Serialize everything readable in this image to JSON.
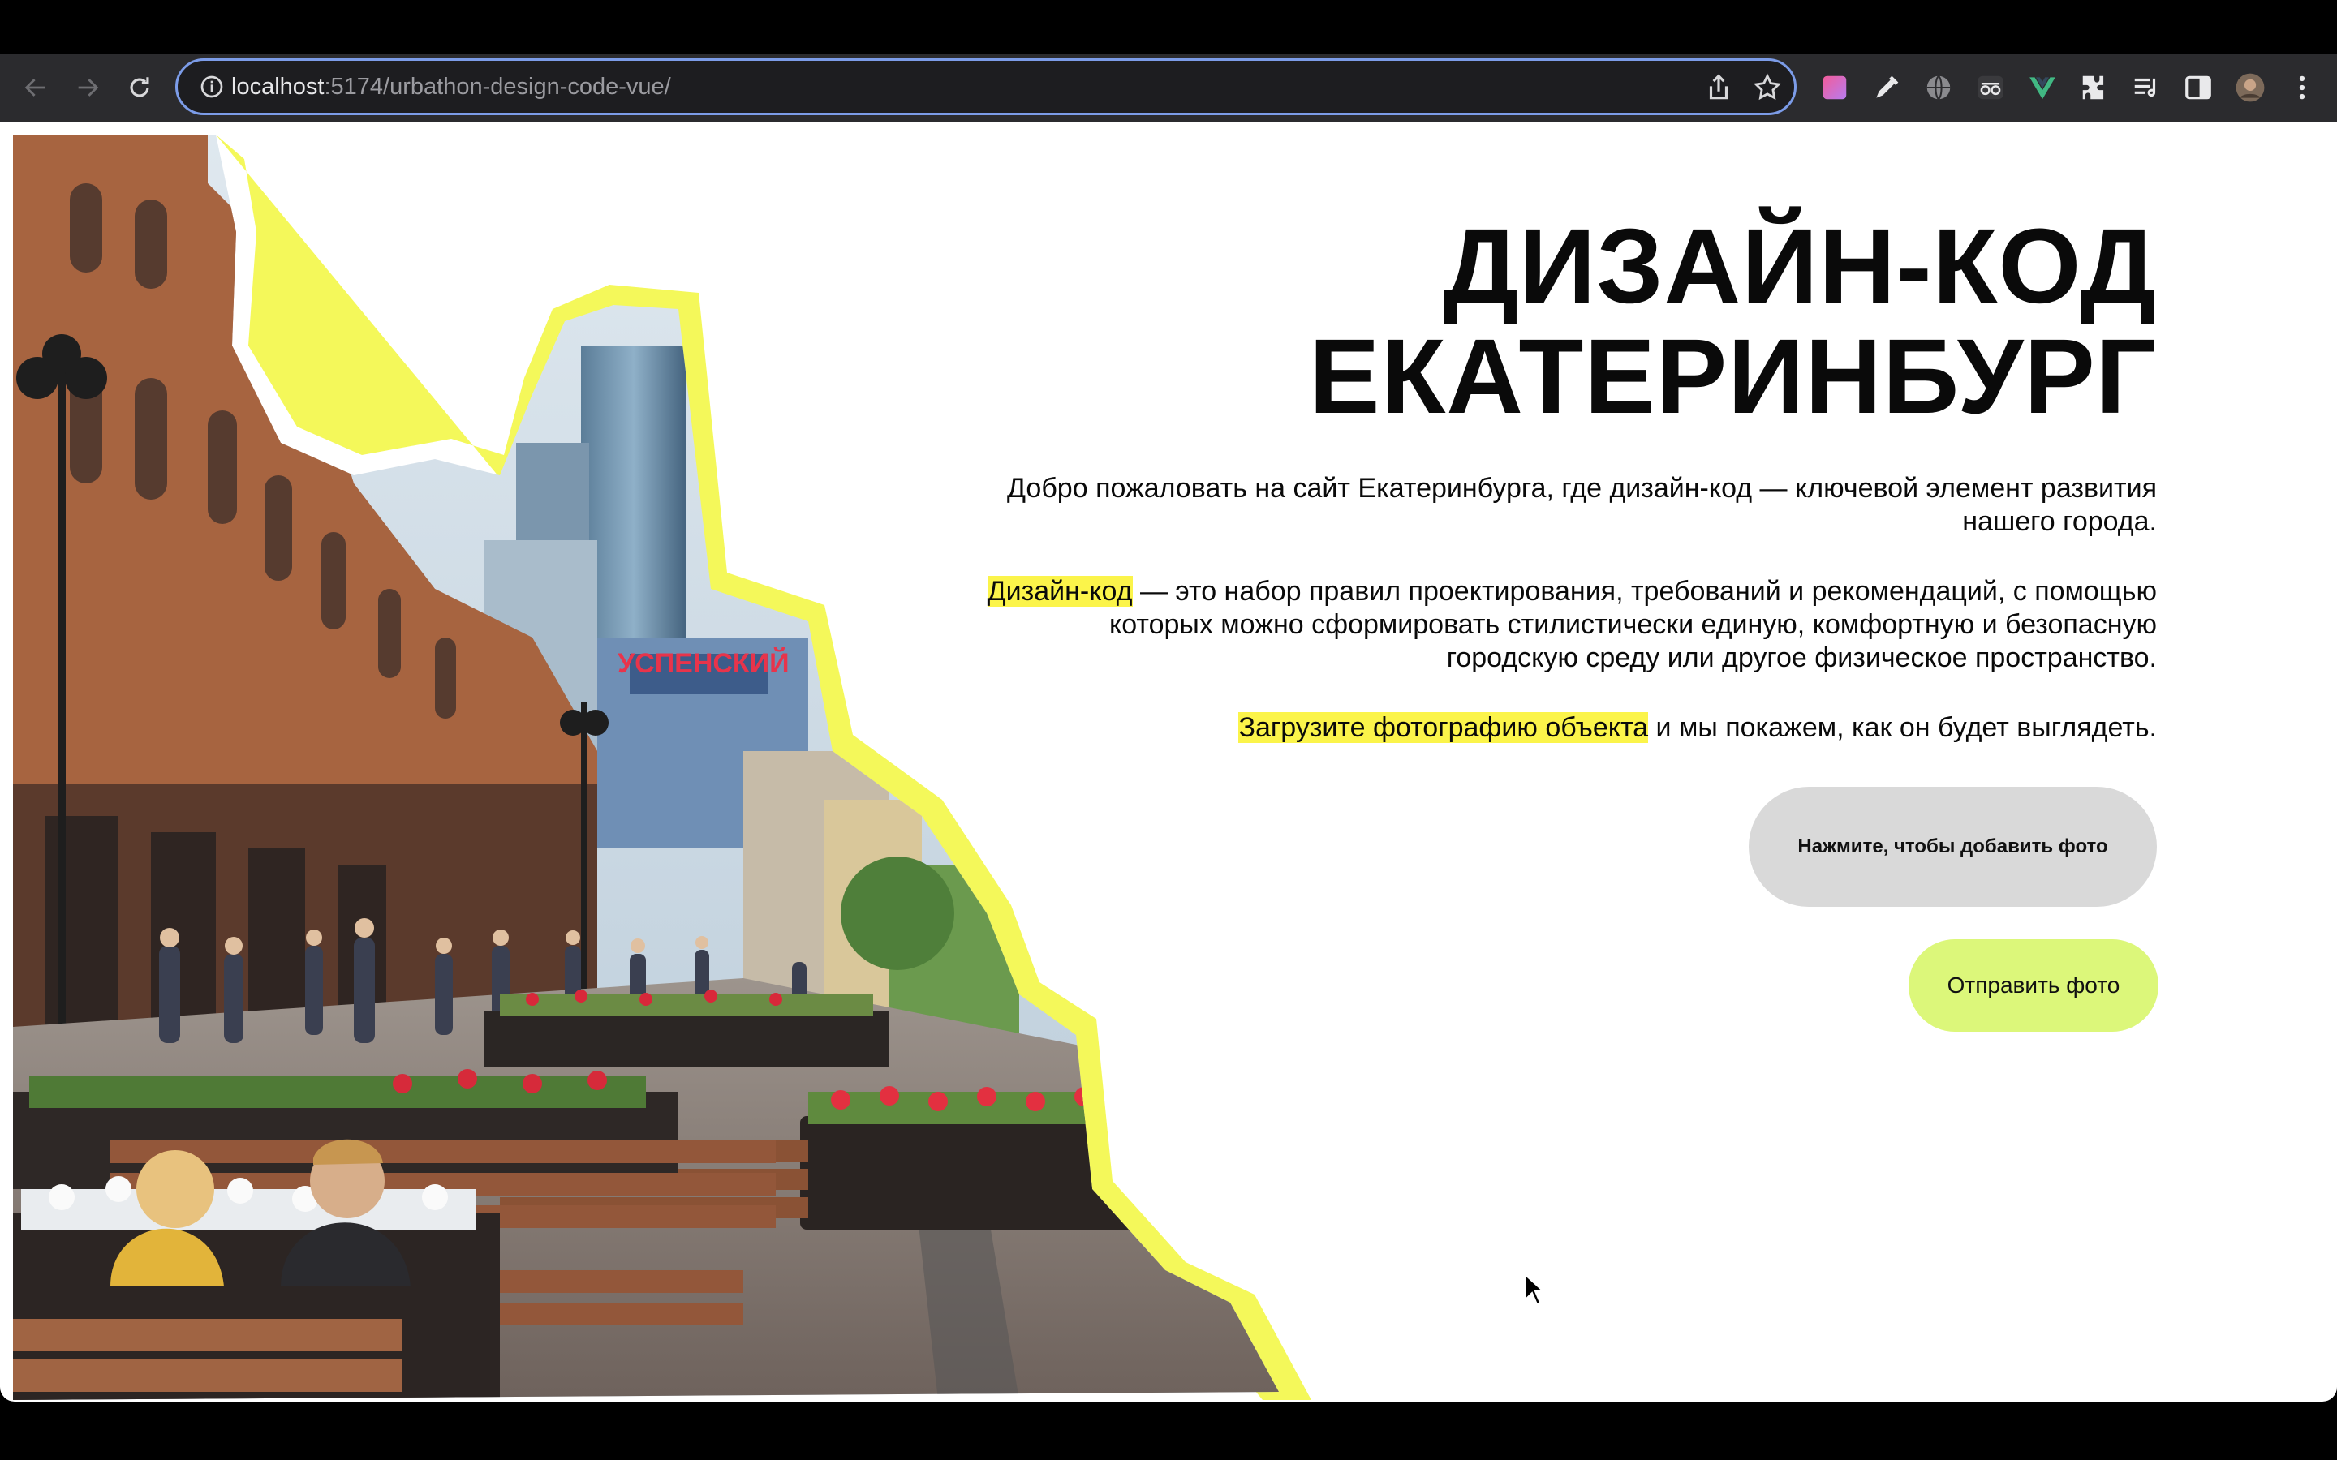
{
  "browser": {
    "url_host": "localhost",
    "url_path": ":5174/urbathon-design-code-vue/",
    "extensions": [
      "color-picker-icon",
      "eyedropper-icon",
      "globe-icon",
      "incognito-glasses-icon",
      "vue-devtools-icon",
      "puzzle-extensions-icon",
      "reading-list-icon",
      "side-panel-icon",
      "profile-avatar",
      "more-menu-icon"
    ]
  },
  "page": {
    "title_line1": "ДИЗАЙН-КОД",
    "title_line2": "ЕКАТЕРИНБУРГ",
    "intro": "Добро пожаловать на сайт Екатеринбурга, где дизайн-код — ключевой элемент развития нашего города.",
    "definition_highlight": "Дизайн-код",
    "definition_rest": " — это набор правил проектирования, требований и рекомендаций, с помощью которых можно сформировать стилистически единую, комфортную и безопасную городскую среду или другое физическое пространство.",
    "cta_highlight": "Загрузите фотографию объекта",
    "cta_rest": " и мы покажем, как он будет выглядеть.",
    "upload_label": "Нажмите, чтобы добавить фото",
    "send_label": "Отправить фото",
    "photo_sign": "УСПЕНСКИЙ"
  },
  "colors": {
    "highlight": "#fbf44a",
    "send_button": "#dcf77a",
    "upload_button": "#d9d9d9",
    "omnibox_focus": "#7c9ce8"
  }
}
